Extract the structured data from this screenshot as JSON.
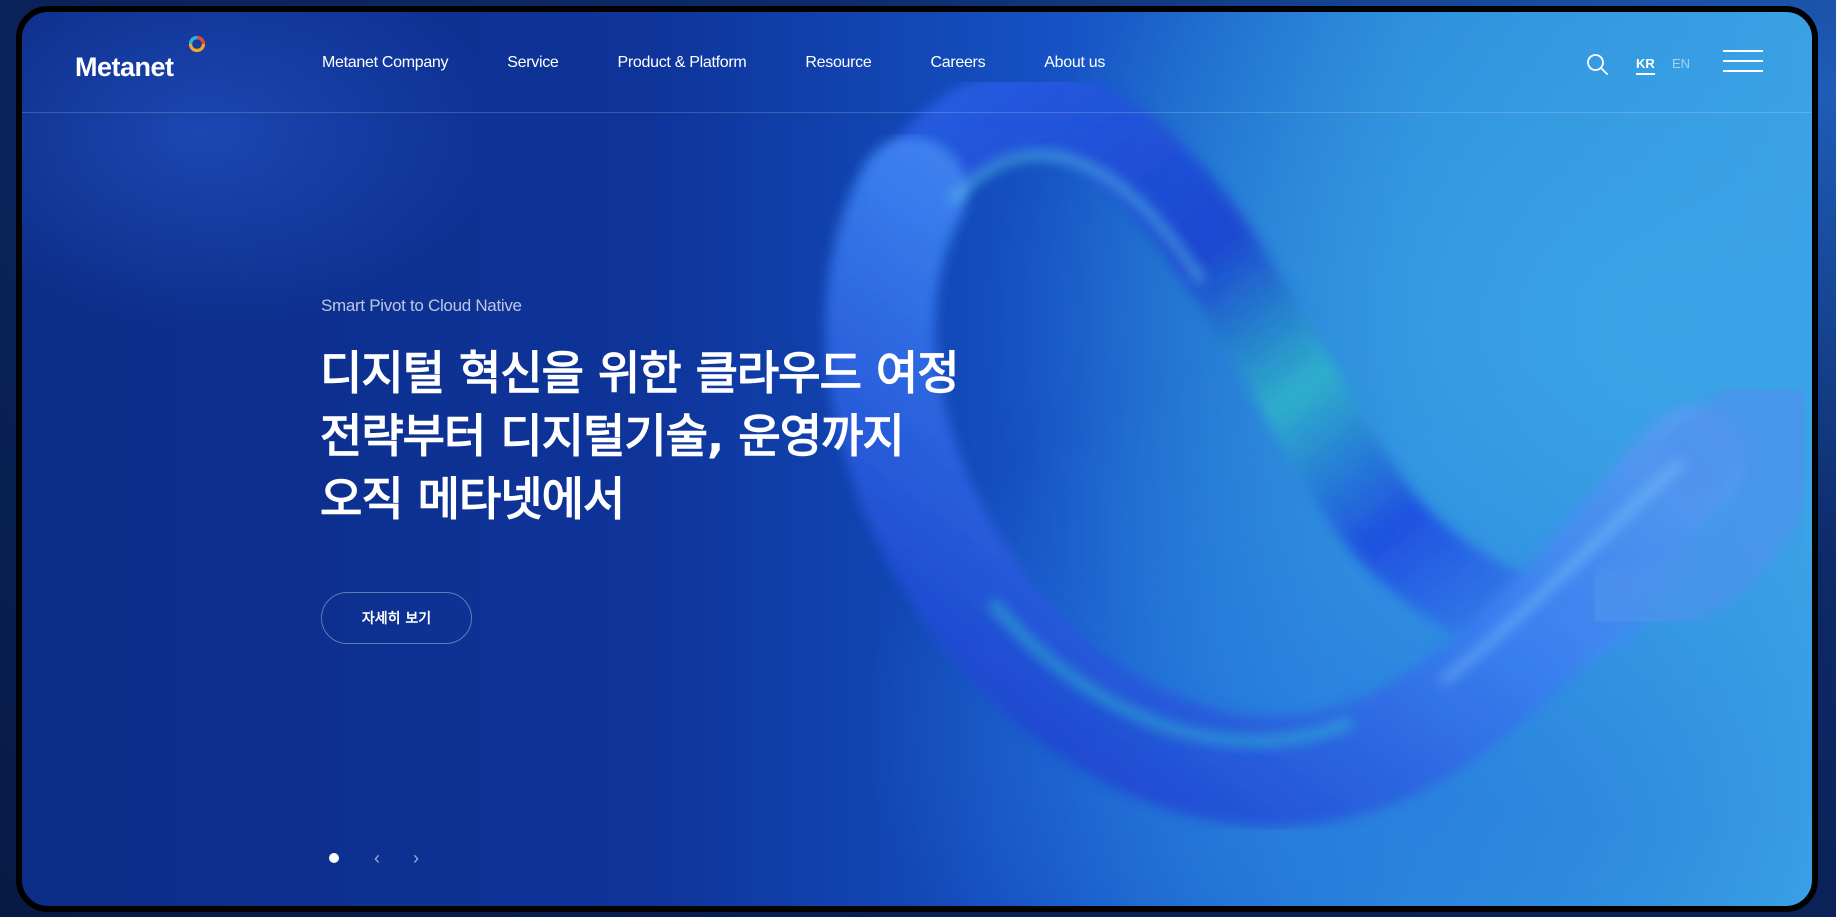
{
  "header": {
    "logo": "Metanet",
    "nav": [
      "Metanet Company",
      "Service",
      "Product & Platform",
      "Resource",
      "Careers",
      "About us"
    ],
    "lang_active": "KR",
    "lang_other": "EN",
    "icons": {
      "search": "search-icon",
      "menu": "hamburger-menu-icon"
    }
  },
  "hero": {
    "eyebrow": "Smart Pivot to Cloud Native",
    "headline": [
      "디지털 혁신을 위한 클라우드 여정",
      "전략부터 디지털기술, 운영까지",
      "오직 메타넷에서"
    ],
    "cta": "자세히 보기"
  },
  "pager": {
    "prev": "‹",
    "next": "›",
    "active_slide": 1,
    "total_slides": 1
  },
  "colors": {
    "background_deep": "#0c2d86",
    "background_light": "#3aa0e4",
    "text": "#ffffff"
  }
}
